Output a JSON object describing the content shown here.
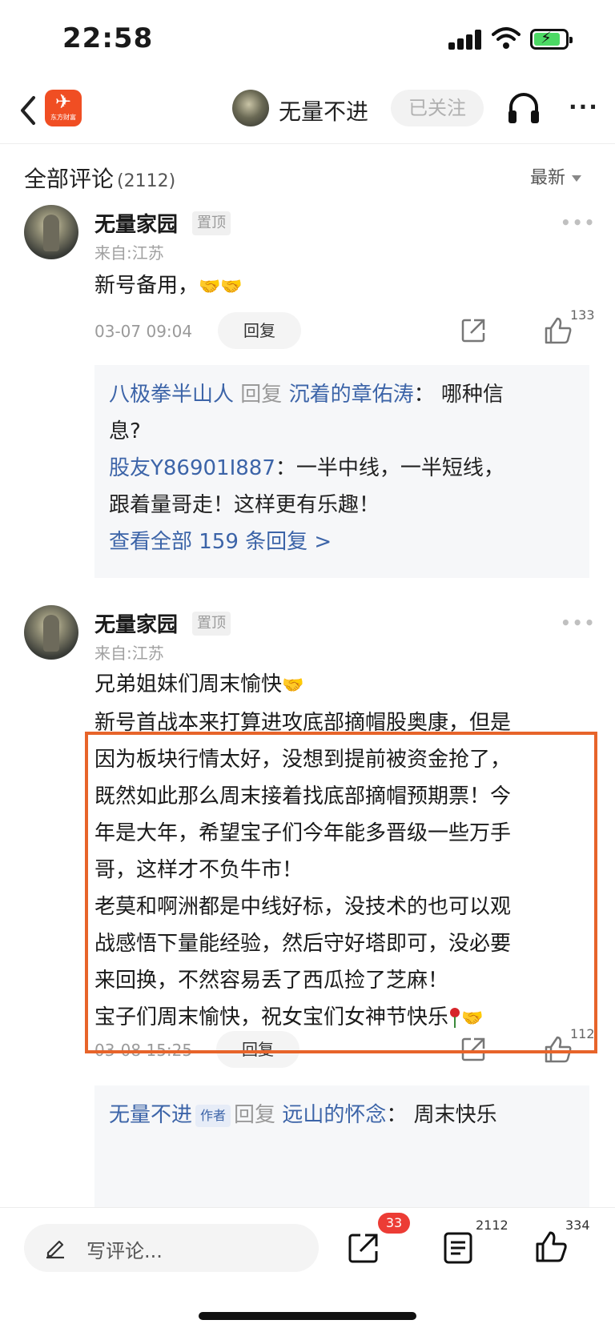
{
  "status_bar": {
    "time": "22:58"
  },
  "nav": {
    "logo_sub": "东方财富",
    "author_name": "无量不进",
    "follow_label": "已关注"
  },
  "comments_header": {
    "title": "全部评论",
    "count": "(2112)",
    "sort_label": "最新"
  },
  "comments": [
    {
      "name": "无量家园",
      "pin_label": "置顶",
      "location": "来自:江苏",
      "body_lines": [
        "新号备用，"
      ],
      "time": "03-07 09:04",
      "reply_label": "回复",
      "like_count": "133",
      "replies": {
        "r1_user": "八极拳半山人",
        "r1_verb": "回复",
        "r1_target": "沉着的章佑涛",
        "r1_text_a": "：  哪种信",
        "r1_text_b": "息?",
        "r2_user": "股友Y86901I887",
        "r2_text_a": "：一半中线，一半短线，",
        "r2_text_b": "跟着量哥走！这样更有乐趣！",
        "view_all": "查看全部 159 条回复 >"
      }
    },
    {
      "name": "无量家园",
      "pin_label": "置顶",
      "location": "来自:江苏",
      "body_lines": [
        "兄弟姐妹们周末愉快",
        "新号首战本来打算进攻底部摘帽股奥康，但是",
        "因为板块行情太好，没想到提前被资金抢了，",
        "既然如此那么周末接着找底部摘帽预期票！今",
        "年是大年，希望宝子们今年能多晋级一些万手",
        "哥，这样才不负牛市！",
        "老莫和啊洲都是中线好标，没技术的也可以观",
        "战感悟下量能经验，然后守好塔即可，没必要",
        "来回换，不然容易丢了西瓜捡了芝麻！",
        "宝子们周末愉快，祝女宝们女神节快乐"
      ],
      "time": "03-08 15:25",
      "reply_label": "回复",
      "like_count": "112",
      "replies": {
        "r1_user": "无量不进",
        "r1_tag": "作者",
        "r1_verb": "回复",
        "r1_target": "远山的怀念",
        "r1_text": "：  周末快乐"
      }
    }
  ],
  "bottom_bar": {
    "input_placeholder": "写评论...",
    "share_badge": "33",
    "comment_count": "2112",
    "like_count": "334"
  },
  "colors": {
    "accent_orange": "#e7642a",
    "link_blue": "#3c64a8",
    "badge_red": "#ec3c35",
    "logo_red": "#f04e23"
  }
}
